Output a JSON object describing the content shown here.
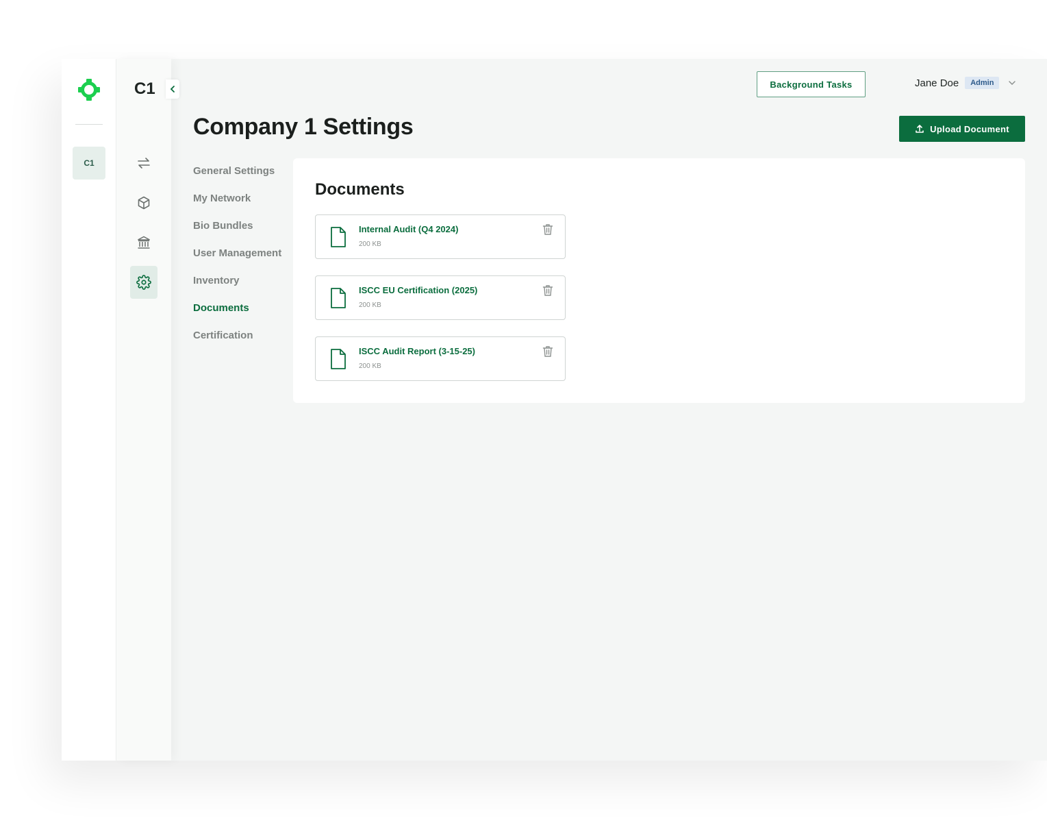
{
  "sidebar": {
    "org_badge": "C1",
    "company_short": "C1"
  },
  "header": {
    "background_tasks_label": "Background Tasks",
    "user_name": "Jane Doe",
    "user_role": "Admin"
  },
  "page": {
    "title": "Company 1 Settings",
    "upload_label": "Upload Document"
  },
  "settings_nav": [
    {
      "label": "General Settings"
    },
    {
      "label": "My Network"
    },
    {
      "label": "Bio Bundles"
    },
    {
      "label": "User Management"
    },
    {
      "label": "Inventory"
    },
    {
      "label": "Documents",
      "active": true
    },
    {
      "label": "Certification"
    }
  ],
  "documents": {
    "title": "Documents",
    "items": [
      {
        "name": "Internal Audit (Q4 2024)",
        "size": "200 KB"
      },
      {
        "name": "ISCC EU Certification (2025)",
        "size": "200 KB"
      },
      {
        "name": "ISCC Audit Report (3-15-25)",
        "size": "200 KB"
      }
    ]
  },
  "colors": {
    "brand_green": "#0b6d3e",
    "logo_green": "#1ccf4f",
    "badge_bg": "#dde7f3",
    "badge_text": "#2d5a8a"
  }
}
